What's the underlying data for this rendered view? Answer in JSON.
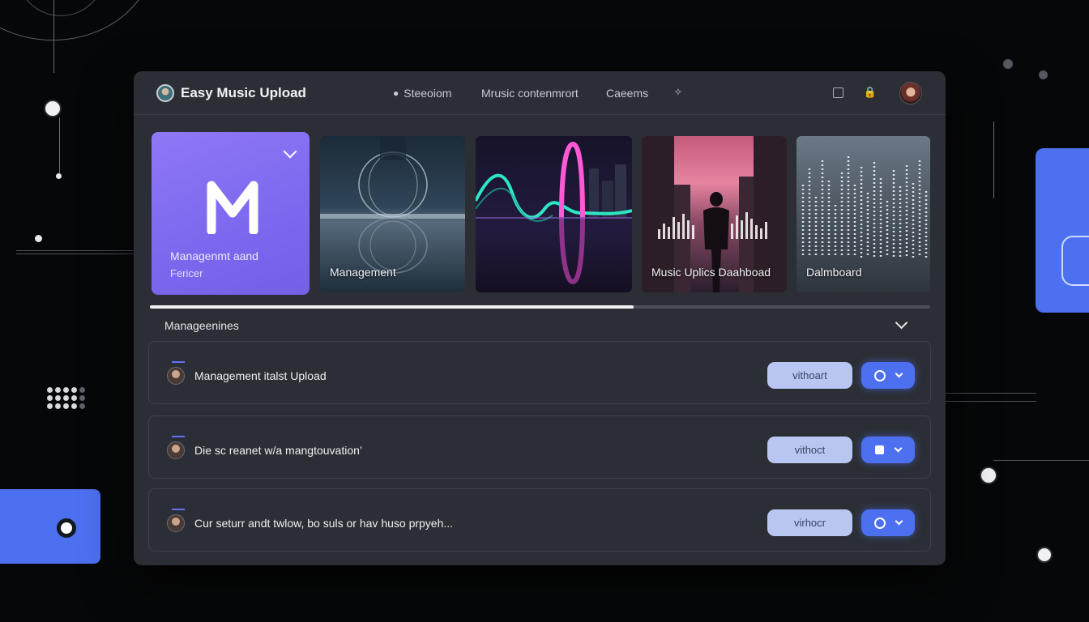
{
  "app": {
    "title": "Easy Music Upload"
  },
  "nav": {
    "items": [
      {
        "label": "Steeoiom",
        "icon": "tag-icon"
      },
      {
        "label": "Mrusic contenmrort"
      },
      {
        "label": "Caeems"
      }
    ]
  },
  "cards": [
    {
      "line1": "Managenmt aand",
      "line2": "Fericer",
      "logo_letter": "M"
    },
    {
      "label": "Management"
    },
    {
      "label": ""
    },
    {
      "label": "Music Uplics Daahboad"
    },
    {
      "label": "Dalmboard"
    }
  ],
  "progress": {
    "fraction": 0.62
  },
  "section": {
    "title": "Manageenines"
  },
  "rows": [
    {
      "text": "Management italst Upload",
      "pill": "vithoart",
      "action_icon": "refresh-icon"
    },
    {
      "text": "Die sc reanet w/a mangtouvation’",
      "pill": "vithoct",
      "action_icon": "stop-icon"
    },
    {
      "text": "Cur seturr andt twlow, bo suls or hav huso prpyeh...",
      "pill": "virhocr",
      "action_icon": "refresh-icon"
    }
  ],
  "colors": {
    "accent": "#4c70f0",
    "featured_card": "#7b68ee",
    "pill": "#b9c6f2",
    "window": "#2b2e34",
    "background": "#060708"
  }
}
